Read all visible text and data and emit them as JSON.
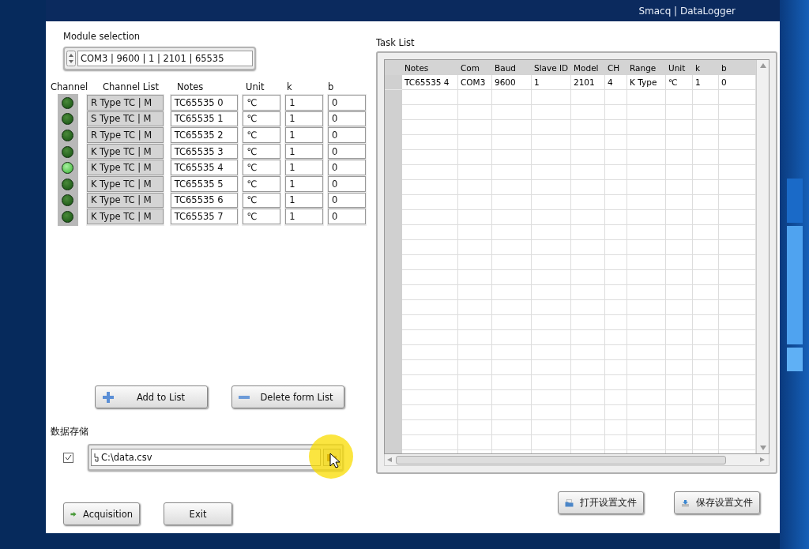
{
  "window": {
    "title": "Smacq | DataLogger"
  },
  "module_selection": {
    "label": "Module selection",
    "value": "COM3 | 9600 | 1 | 2101 | 65535"
  },
  "channel_table": {
    "columns": [
      "Channel",
      "Channel List",
      "Notes",
      "Unit",
      "k",
      "b"
    ],
    "rows": [
      {
        "lit": false,
        "channel_list": "R Type TC | M",
        "notes": "TC65535 0",
        "unit": "℃",
        "k": "1",
        "b": "0"
      },
      {
        "lit": false,
        "channel_list": "S Type TC | M",
        "notes": "TC65535 1",
        "unit": "℃",
        "k": "1",
        "b": "0"
      },
      {
        "lit": false,
        "channel_list": "R Type TC | M",
        "notes": "TC65535 2",
        "unit": "℃",
        "k": "1",
        "b": "0"
      },
      {
        "lit": false,
        "channel_list": "K Type TC | M",
        "notes": "TC65535 3",
        "unit": "℃",
        "k": "1",
        "b": "0"
      },
      {
        "lit": true,
        "channel_list": "K Type TC | M",
        "notes": "TC65535 4",
        "unit": "℃",
        "k": "1",
        "b": "0"
      },
      {
        "lit": false,
        "channel_list": "K Type TC | M",
        "notes": "TC65535 5",
        "unit": "℃",
        "k": "1",
        "b": "0"
      },
      {
        "lit": false,
        "channel_list": "K Type TC | M",
        "notes": "TC65535 6",
        "unit": "℃",
        "k": "1",
        "b": "0"
      },
      {
        "lit": false,
        "channel_list": "K Type TC | M",
        "notes": "TC65535 7",
        "unit": "℃",
        "k": "1",
        "b": "0"
      }
    ]
  },
  "list_buttons": [
    "Add to List",
    "Delete form List"
  ],
  "data_storage": {
    "label": "数据存储",
    "checked": true,
    "path": "C:\\data.csv"
  },
  "bottom_buttons": [
    "Acquisition",
    "Exit"
  ],
  "task_list": {
    "label": "Task List",
    "columns": [
      "Notes",
      "Com",
      "Baud",
      "Slave ID",
      "Model",
      "CH",
      "Range",
      "Unit",
      "k",
      "b"
    ],
    "rows": [
      [
        "TC65535 4",
        "COM3",
        "9600",
        "1",
        "2101",
        "4",
        "K Type",
        "℃",
        "1",
        "0"
      ]
    ]
  },
  "file_buttons": [
    "打开设置文件",
    "保存设置文件"
  ]
}
